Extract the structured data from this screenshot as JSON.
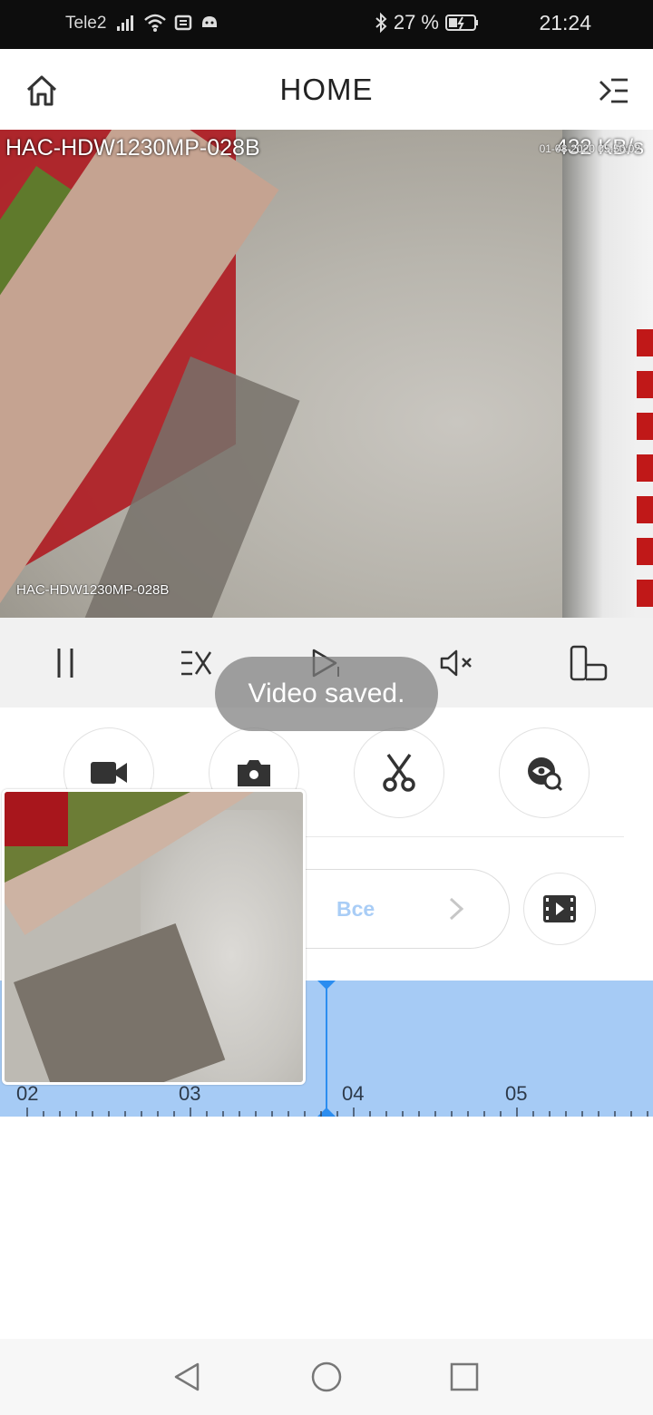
{
  "status_bar": {
    "carrier": "Tele2",
    "battery": "27 %",
    "time": "21:24",
    "icons": [
      "signal-icon",
      "wifi-icon",
      "message-icon",
      "app-notification-icon",
      "bluetooth-icon",
      "battery-icon"
    ]
  },
  "header": {
    "title": "HOME",
    "home_icon": "home-icon",
    "menu_icon": "menu-collapse-icon"
  },
  "video": {
    "camera_name_top": "HAC-HDW1230MP-028B",
    "bitrate": "432 KB/s",
    "timestamp": "01-08-2020 05:50:02",
    "camera_name_bottom": "HAC-HDW1230MP-028B"
  },
  "controls": [
    {
      "name": "pause",
      "icon": "pause-icon"
    },
    {
      "name": "speed",
      "icon": "speed-icon"
    },
    {
      "name": "play-next",
      "icon": "play-next-icon"
    },
    {
      "name": "mute",
      "icon": "mute-icon"
    },
    {
      "name": "rotate",
      "icon": "rotate-screen-icon"
    }
  ],
  "toast": "Video saved.",
  "actions": [
    {
      "name": "record",
      "icon": "video-camera-icon"
    },
    {
      "name": "snapshot",
      "icon": "camera-icon"
    },
    {
      "name": "clip",
      "icon": "scissors-icon"
    },
    {
      "name": "smart-search",
      "icon": "eye-search-icon"
    }
  ],
  "filter": {
    "label": "Все",
    "chevron_icon": "chevron-right-icon",
    "clip_icon": "film-play-icon"
  },
  "timeline": {
    "labels": [
      "02",
      "03",
      "04",
      "05"
    ],
    "colors": {
      "track": "#a6cbf5",
      "cursor": "#2b8df0"
    }
  },
  "nav_bar": {
    "icons": [
      "back-icon",
      "home-circle-icon",
      "recents-icon"
    ]
  },
  "colors": {
    "accent_blue": "#2b8df0",
    "filter_label": "#a9cdf6",
    "status_bar_bg": "#0d0d0d"
  }
}
